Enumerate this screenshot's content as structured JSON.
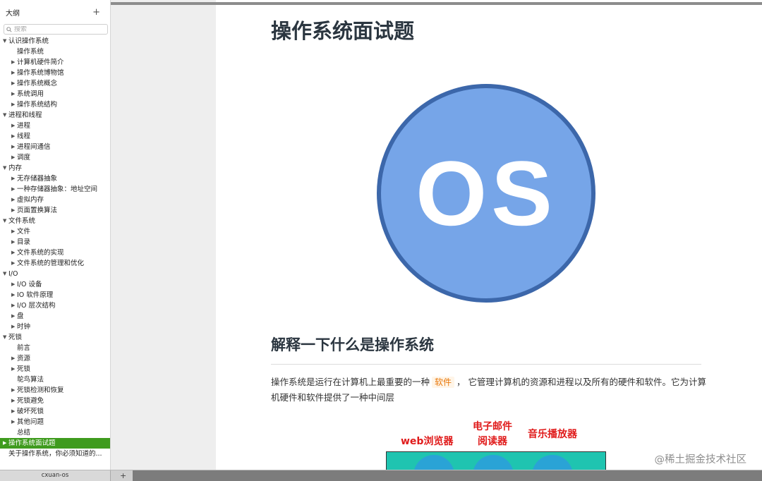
{
  "sidebar": {
    "title": "大纲",
    "add_label": "+",
    "search_placeholder": "搜索",
    "items": [
      {
        "label": "认识操作系统",
        "level": 1,
        "arrow": "▼"
      },
      {
        "label": "操作系统",
        "level": 2,
        "arrow": ""
      },
      {
        "label": "计算机硬件简介",
        "level": 2,
        "arrow": "▶"
      },
      {
        "label": "操作系统博物馆",
        "level": 2,
        "arrow": "▶"
      },
      {
        "label": "操作系统概念",
        "level": 2,
        "arrow": "▶"
      },
      {
        "label": "系统调用",
        "level": 2,
        "arrow": "▶"
      },
      {
        "label": "操作系统结构",
        "level": 2,
        "arrow": "▶"
      },
      {
        "label": "进程和线程",
        "level": 1,
        "arrow": "▼"
      },
      {
        "label": "进程",
        "level": 2,
        "arrow": "▶"
      },
      {
        "label": "线程",
        "level": 2,
        "arrow": "▶"
      },
      {
        "label": "进程间通信",
        "level": 2,
        "arrow": "▶"
      },
      {
        "label": "调度",
        "level": 2,
        "arrow": "▶"
      },
      {
        "label": "内存",
        "level": 1,
        "arrow": "▼"
      },
      {
        "label": "无存储器抽象",
        "level": 2,
        "arrow": "▶"
      },
      {
        "label": "一种存储器抽象：地址空间",
        "level": 2,
        "arrow": "▶"
      },
      {
        "label": "虚拟内存",
        "level": 2,
        "arrow": "▶"
      },
      {
        "label": "页面置换算法",
        "level": 2,
        "arrow": "▶"
      },
      {
        "label": "文件系统",
        "level": 1,
        "arrow": "▼"
      },
      {
        "label": "文件",
        "level": 2,
        "arrow": "▶"
      },
      {
        "label": "目录",
        "level": 2,
        "arrow": "▶"
      },
      {
        "label": "文件系统的实现",
        "level": 2,
        "arrow": "▶"
      },
      {
        "label": "文件系统的管理和优化",
        "level": 2,
        "arrow": "▶"
      },
      {
        "label": "I/O",
        "level": 1,
        "arrow": "▼"
      },
      {
        "label": "I/O 设备",
        "level": 2,
        "arrow": "▶"
      },
      {
        "label": "IO 软件原理",
        "level": 2,
        "arrow": "▶"
      },
      {
        "label": "I/O 层次结构",
        "level": 2,
        "arrow": "▶"
      },
      {
        "label": "盘",
        "level": 2,
        "arrow": "▶"
      },
      {
        "label": "时钟",
        "level": 2,
        "arrow": "▶"
      },
      {
        "label": "死锁",
        "level": 1,
        "arrow": "▼"
      },
      {
        "label": "前言",
        "level": 2,
        "arrow": ""
      },
      {
        "label": "资源",
        "level": 2,
        "arrow": "▶"
      },
      {
        "label": "死锁",
        "level": 2,
        "arrow": "▶"
      },
      {
        "label": "鸵鸟算法",
        "level": 2,
        "arrow": ""
      },
      {
        "label": "死锁检测和恢复",
        "level": 2,
        "arrow": "▶"
      },
      {
        "label": "死锁避免",
        "level": 2,
        "arrow": "▶"
      },
      {
        "label": "破坏死锁",
        "level": 2,
        "arrow": "▶"
      },
      {
        "label": "其他问题",
        "level": 2,
        "arrow": "▶"
      },
      {
        "label": "总结",
        "level": 2,
        "arrow": ""
      },
      {
        "label": "操作系统面试题",
        "level": 1,
        "arrow": "▶",
        "active": true
      },
      {
        "label": "关于操作系统，你必须知道的...",
        "level": 0,
        "arrow": ""
      }
    ]
  },
  "document": {
    "title": "操作系统面试题",
    "logo_text": "OS",
    "section_heading": "解释一下什么是操作系统",
    "paragraph_before": "操作系统是运行在计算机上最重要的一种",
    "paragraph_code": "软件",
    "paragraph_after": "， 它管理计算机的资源和进程以及所有的硬件和软件。它为计算机硬件和软件提供了一种中间层",
    "figure_labels": {
      "browser": "web浏览器",
      "email_line1": "电子邮件",
      "email_line2": "阅读器",
      "music": "音乐播放器"
    },
    "colors": {
      "logo_fill": "#76a5e8",
      "logo_ring": "#3c67aa",
      "figure_label": "#e01b1b",
      "active_outline": "#3f9b1e"
    }
  },
  "watermark": "@稀土掘金技术社区",
  "bottom_bar": {
    "tab_label": "cxuan-os",
    "add_tab_label": "+"
  }
}
